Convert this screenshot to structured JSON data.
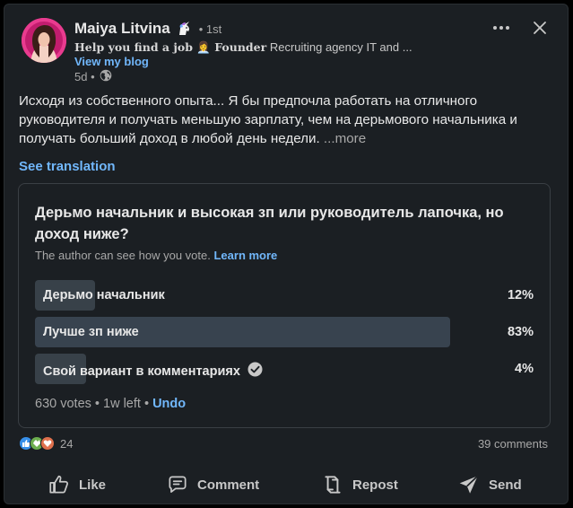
{
  "author": {
    "name": "Maiya Litvina",
    "degree": "• 1st",
    "headline_bold": "Help you find a job 👩‍💼 Founder",
    "headline_rest": " Recruiting agency IT and ...",
    "view_blog": "View my blog",
    "age": "5d •"
  },
  "post": {
    "text": "Исходя из собственного опыта... Я бы предпочла работать на отличного руководителя и получать меньшую зарплату, чем на дерьмового начальника и получать больший доход в любой день недели.",
    "more": "  ...more",
    "see_translation": "See translation"
  },
  "poll": {
    "question": "Дерьмо начальник и высокая зп или руководитель лапочка, но доход ниже?",
    "note": "The author can see how you vote.",
    "learn_more": "Learn more",
    "options": [
      {
        "label": "Дерьмо начальник",
        "percent": "12%",
        "fill": 0.12
      },
      {
        "label": "Лучше зп ниже",
        "percent": "83%",
        "fill": 0.83
      },
      {
        "label": "Свой вариант в комментариях",
        "percent": "4%",
        "fill": 0.04,
        "selected": true
      }
    ],
    "votes": "630 votes • 1w left • ",
    "undo": "Undo"
  },
  "social": {
    "reactions_count": "24",
    "comments": "39 comments"
  },
  "actions": {
    "like": "Like",
    "comment": "Comment",
    "repost": "Repost",
    "send": "Send"
  },
  "colors": {
    "background": "#1b1f23",
    "link": "#71b7fb",
    "poll_fill": "#38434f",
    "muted": "#a8a8a8"
  },
  "icons": [
    "unicorn-icon",
    "globe-icon",
    "more-icon",
    "close-icon",
    "check-circle-icon",
    "like-icon",
    "comment-icon",
    "repost-icon",
    "send-icon"
  ]
}
